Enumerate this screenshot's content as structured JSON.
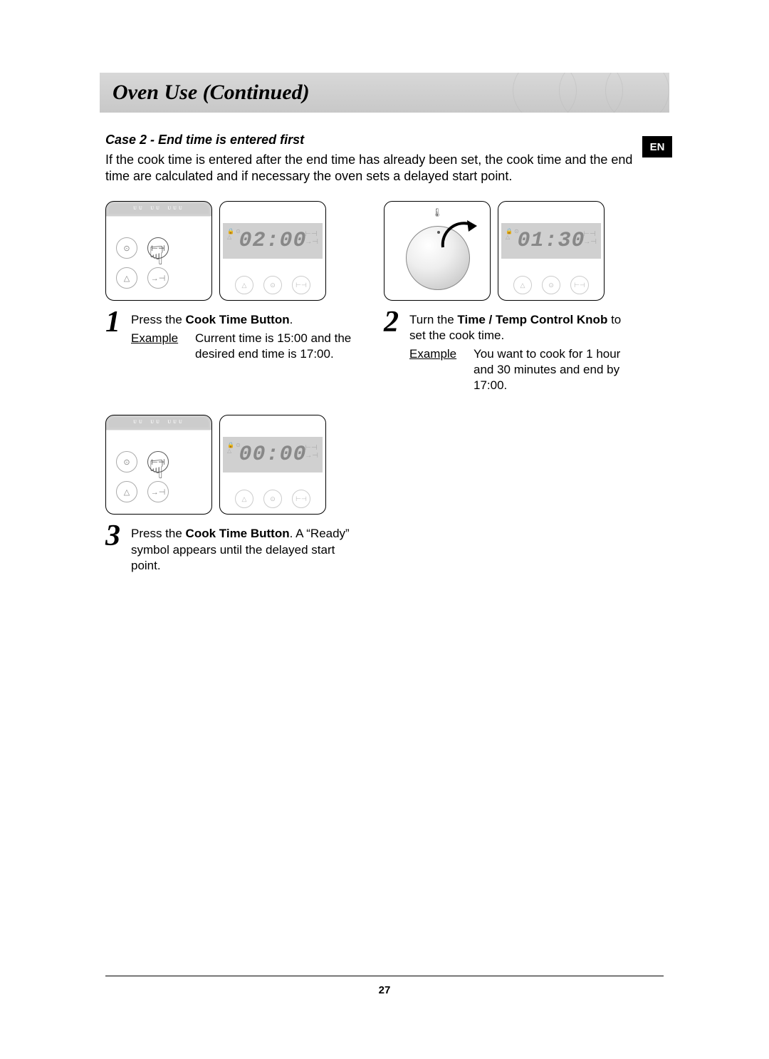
{
  "header": {
    "title": "Oven Use (Continued)"
  },
  "language_badge": "EN",
  "case": {
    "title": "Case 2 - End time is entered first",
    "intro": "If the cook time is entered after the end time has already been set, the cook time and the end time are calculated and if necessary the oven sets a delayed start point."
  },
  "steps": [
    {
      "number": "1",
      "display_value": "02:00",
      "figure_type": "press",
      "text_prefix": "Press the ",
      "bold": "Cook Time Button",
      "text_suffix": ".",
      "example_label": "Example",
      "example_text": "Current time is 15:00 and the desired end time is 17:00."
    },
    {
      "number": "2",
      "display_value": "01:30",
      "figure_type": "knob",
      "text_prefix": "Turn the ",
      "bold": "Time / Temp Control Knob",
      "text_suffix": " to set the cook time.",
      "example_label": "Example",
      "example_text": "You want to cook for 1 hour and 30 minutes and end by 17:00."
    },
    {
      "number": "3",
      "display_value": "00:00",
      "figure_type": "press",
      "text_prefix": "Press the ",
      "bold": "Cook Time Button",
      "text_suffix": ". A “Ready” symbol appears until the delayed start point."
    }
  ],
  "page_number": "27"
}
